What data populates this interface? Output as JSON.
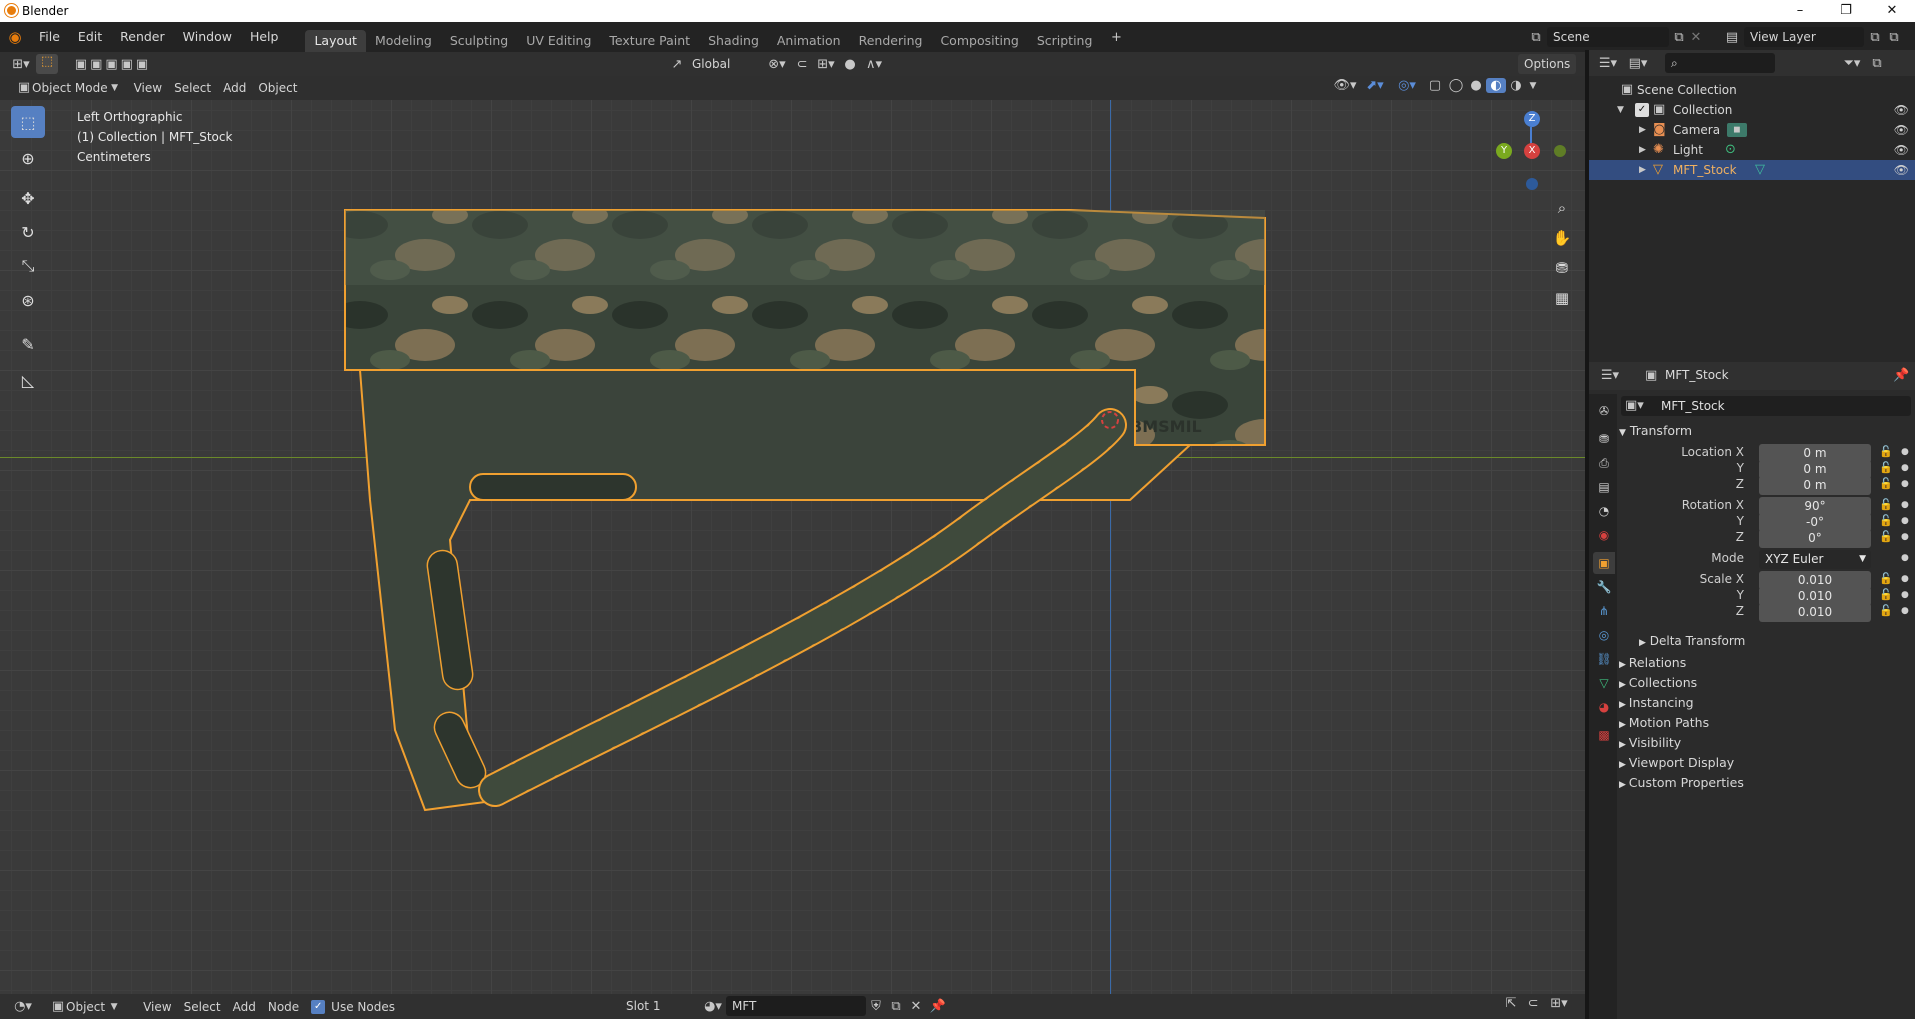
{
  "window": {
    "title": "Blender",
    "minimize": "–",
    "restore": "❐",
    "close": "✕"
  },
  "menu": {
    "file": "File",
    "edit": "Edit",
    "render": "Render",
    "window": "Window",
    "help": "Help"
  },
  "workspaces": [
    "Layout",
    "Modeling",
    "Sculpting",
    "UV Editing",
    "Texture Paint",
    "Shading",
    "Animation",
    "Rendering",
    "Compositing",
    "Scripting"
  ],
  "add_workspace": "+",
  "scene": {
    "name": "Scene",
    "view_layer": "View Layer"
  },
  "tool_header": {
    "transform_orientation": "Global",
    "options": "Options"
  },
  "viewport_header": {
    "mode": "Object Mode",
    "view": "View",
    "select": "Select",
    "add": "Add",
    "object": "Object"
  },
  "viewport": {
    "view_name": "Left Orthographic",
    "collection_line": "(1) Collection | MFT_Stock",
    "units": "Centimeters",
    "model_label": "BMSMIL",
    "gizmo": {
      "z": "Z",
      "y": "Y",
      "x": "X"
    }
  },
  "colors": {
    "accent": "#5680c2",
    "selection_outline": "#f0a030",
    "x_axis": "#d6413f",
    "y_axis": "#7aa91f",
    "z_axis": "#4a7fd1",
    "camo_dark": "#2f3a2e",
    "camo_tan": "#8a7a5a"
  },
  "outliner": {
    "root": "Scene Collection",
    "items": [
      {
        "label": "Collection",
        "icon": "collection-icon"
      },
      {
        "label": "Camera",
        "icon": "camera-icon"
      },
      {
        "label": "Light",
        "icon": "light-icon"
      },
      {
        "label": "MFT_Stock",
        "icon": "mesh-icon"
      }
    ]
  },
  "properties": {
    "header_object": "MFT_Stock",
    "object_name": "MFT_Stock",
    "transform_title": "Transform",
    "location_label": "Location X",
    "location": {
      "x": "0 m",
      "y": "0 m",
      "z": "0 m"
    },
    "rotation_label": "Rotation X",
    "rotation": {
      "x": "90°",
      "y": "-0°",
      "z": "0°"
    },
    "mode_label": "Mode",
    "mode_value": "XYZ Euler",
    "scale_label": "Scale X",
    "scale": {
      "x": "0.010",
      "y": "0.010",
      "z": "0.010"
    },
    "axis_y": "Y",
    "axis_z": "Z",
    "delta": "Delta Transform",
    "sections": [
      "Relations",
      "Collections",
      "Instancing",
      "Motion Paths",
      "Visibility",
      "Viewport Display",
      "Custom Properties"
    ]
  },
  "bottom_bar": {
    "editor": "Object",
    "view": "View",
    "select": "Select",
    "add": "Add",
    "node": "Node",
    "use_nodes": "Use Nodes",
    "slot": "Slot 1",
    "material": "MFT"
  }
}
